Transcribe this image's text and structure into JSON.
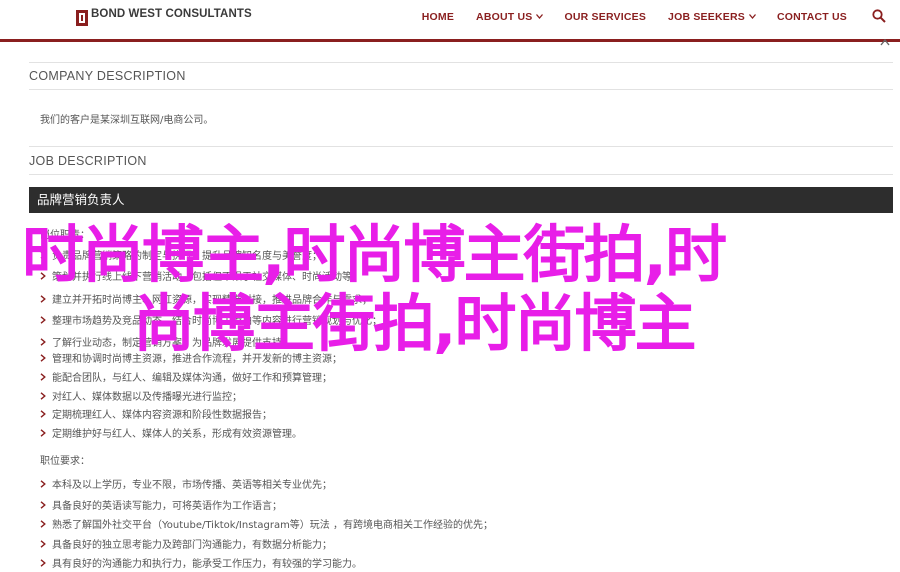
{
  "header": {
    "logo_name": "BOND WEST CONSULTANTS",
    "logo_tagline": "",
    "nav": [
      {
        "label": "HOME",
        "dropdown": false
      },
      {
        "label": "ABOUT US",
        "dropdown": true
      },
      {
        "label": "OUR SERVICES",
        "dropdown": false
      },
      {
        "label": "JOB SEEKERS",
        "dropdown": true
      },
      {
        "label": "CONTACT US",
        "dropdown": false
      }
    ],
    "accent_color": "#8a1f1f"
  },
  "company": {
    "title": "COMPANY DESCRIPTION",
    "text": "我们的客户是某深圳互联网/电商公司。"
  },
  "job": {
    "title": "JOB DESCRIPTION",
    "position_bar": "品牌营销负责人",
    "duties_label": "岗位职责：",
    "duties": [
      "负责品牌营销策略的制定与执行，提升品牌知名度与美誉度；",
      "策划并执行线上线下营销活动，包括但不限于社交媒体、时尚活动等；",
      "建立并开拓时尚博主、网红资源，实现精准对接，推进品牌合作与需求；",
      "整理市场趋势及竞品动态，结合时尚博主街拍等内容进行营销规划与优化；",
      "了解行业动态，制定营销方案，为品牌发展提供支持；",
      "管理和协调时尚博主资源，推进合作流程，并开发新的博主资源；",
      "能配合团队，与红人、编辑及媒体沟通，做好工作和预算管理；",
      "对红人、媒体数据以及传播曝光进行监控；",
      "定期梳理红人、媒体内容资源和阶段性数据报告；",
      "定期维护好与红人、媒体人的关系，形成有效资源管理。"
    ],
    "requirements_label": "职位要求：",
    "requirements": [
      "本科及以上学历，专业不限，市场传播、英语等相关专业优先；",
      "具备良好的英语读写能力，可将英语作为工作语言；",
      "熟悉了解国外社交平台（Youtube/Tiktok/Instagram等）玩法 ，有跨境电商相关工作经验的优先；",
      "具备良好的独立思考能力及跨部门沟通能力，有数据分析能力；",
      "具有良好的沟通能力和执行力，能承受工作压力，有较强的学习能力。"
    ]
  },
  "overlay": {
    "line1": "时尚博主,时尚博主街拍,时",
    "line2": "尚博主街拍,时尚博主",
    "color": "#e81ee8"
  }
}
